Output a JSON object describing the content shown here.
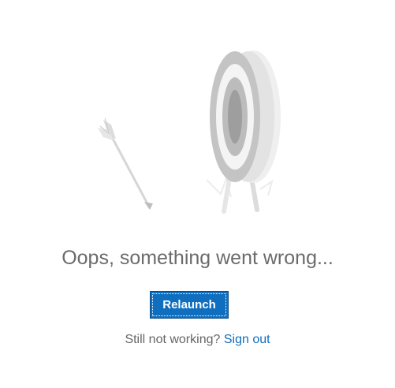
{
  "illustration": {
    "icon": "target-with-missed-arrow-illustration"
  },
  "error": {
    "title": "Oops, something went wrong..."
  },
  "actions": {
    "relaunch_label": "Relaunch"
  },
  "help": {
    "prompt": "Still not working?",
    "signout_label": "Sign out"
  },
  "colors": {
    "accent": "#106ebe",
    "text": "#6b6b6b",
    "illustration_gray": "#c8c8c8"
  }
}
